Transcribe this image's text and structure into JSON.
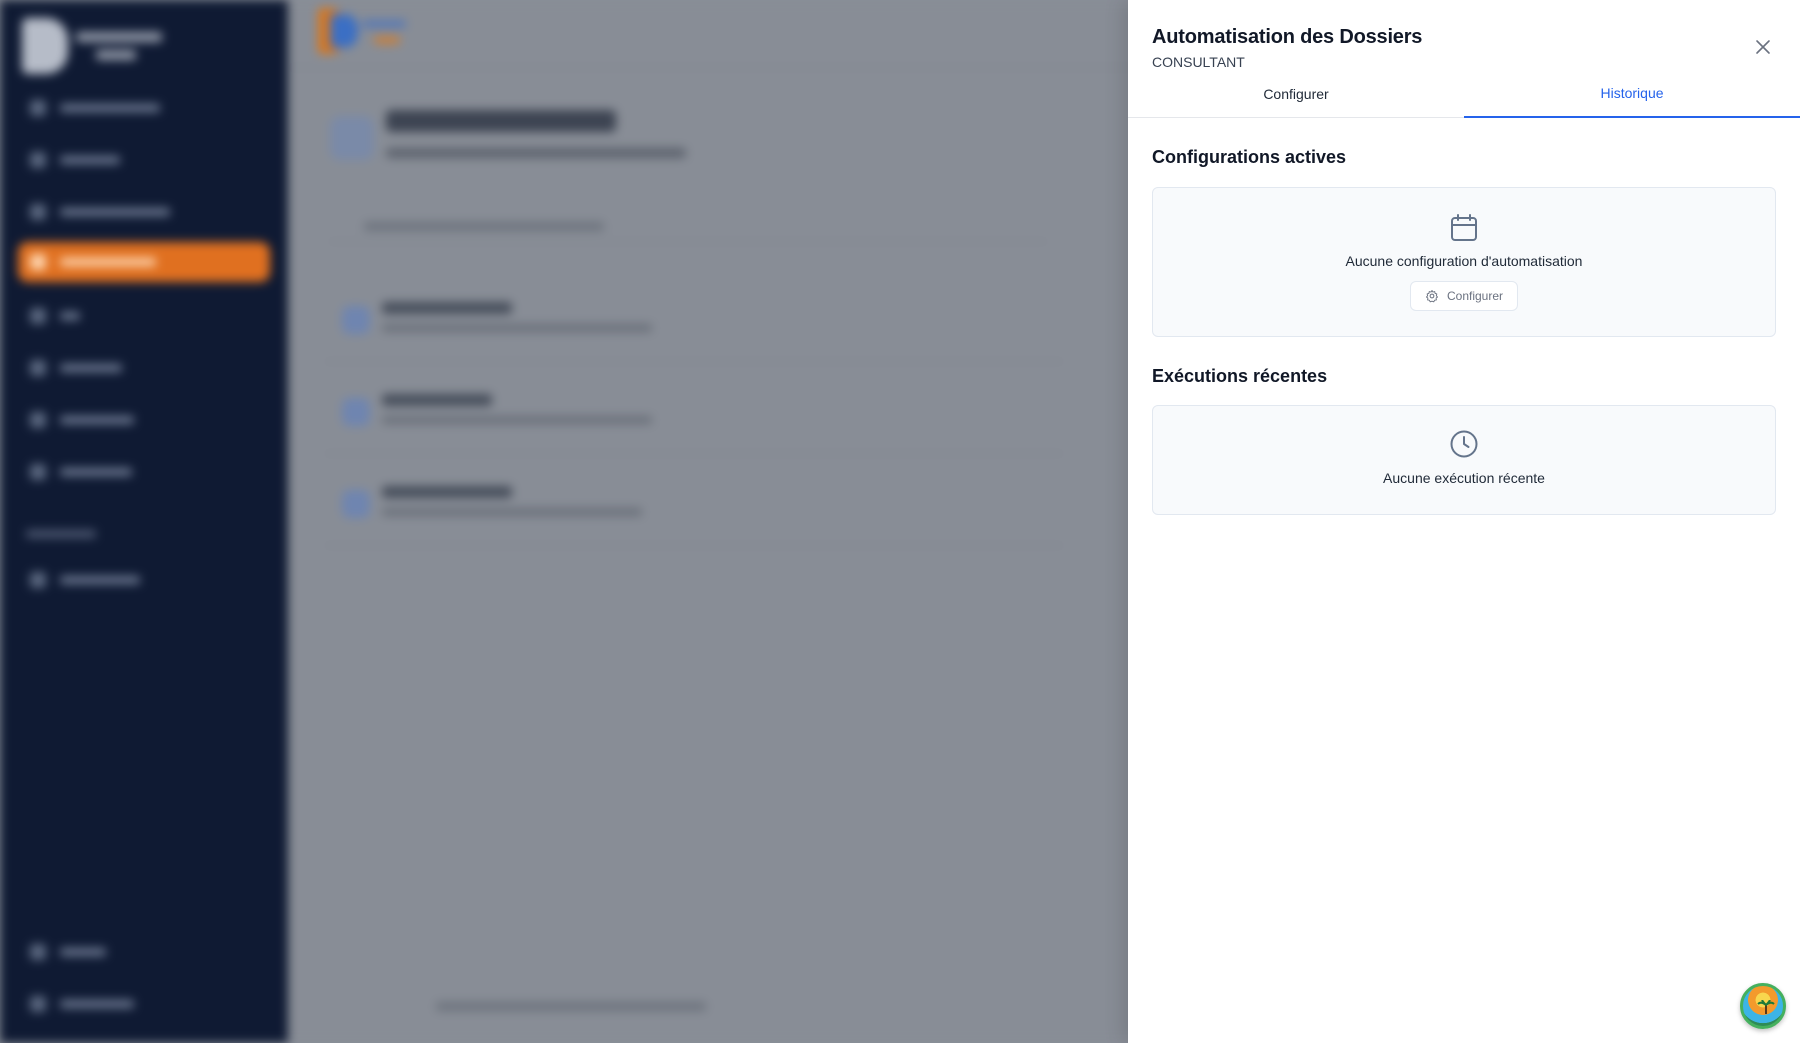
{
  "drawer": {
    "title": "Automatisation des Dossiers",
    "subtitle": "CONSULTANT",
    "tabs": [
      {
        "label": "Configurer",
        "active": false
      },
      {
        "label": "Historique",
        "active": true
      }
    ],
    "active_configs": {
      "title": "Configurations actives",
      "empty_icon": "calendar-icon",
      "empty_text": "Aucune configuration d'automatisation",
      "button_label": "Configurer",
      "button_icon": "gear-icon"
    },
    "recent_runs": {
      "title": "Exécutions récentes",
      "empty_icon": "clock-icon",
      "empty_text": "Aucune exécution récente"
    }
  },
  "colors": {
    "accent": "#2563eb",
    "sidebar_bg": "#0f1a33",
    "sidebar_active": "#e07020",
    "overlay": "#8a8f98"
  }
}
